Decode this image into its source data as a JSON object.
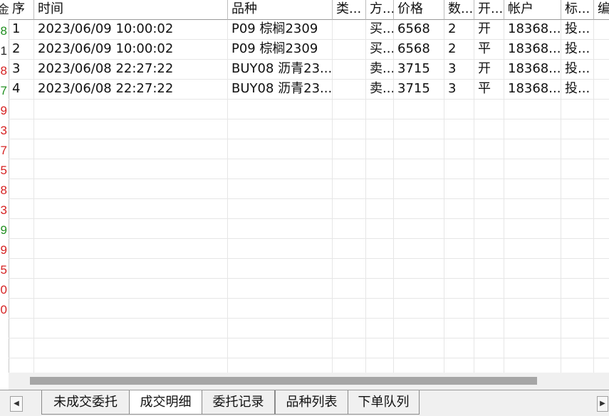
{
  "left_strip": {
    "header": "金",
    "values": [
      {
        "text": "8",
        "color": "#1f8f1f"
      },
      {
        "text": "1",
        "color": "#222222"
      },
      {
        "text": "8",
        "color": "#d62020"
      },
      {
        "text": "7",
        "color": "#1f8f1f"
      },
      {
        "text": "9",
        "color": "#d62020"
      },
      {
        "text": "3",
        "color": "#d62020"
      },
      {
        "text": "7",
        "color": "#d62020"
      },
      {
        "text": "5",
        "color": "#d62020"
      },
      {
        "text": "8",
        "color": "#d62020"
      },
      {
        "text": "3",
        "color": "#d62020"
      },
      {
        "text": "9",
        "color": "#1f8f1f"
      },
      {
        "text": "9",
        "color": "#d62020"
      },
      {
        "text": "5",
        "color": "#d62020"
      },
      {
        "text": "0",
        "color": "#d62020"
      },
      {
        "text": "0",
        "color": "#d62020"
      }
    ]
  },
  "table": {
    "columns": [
      "序",
      "时间",
      "品种",
      "类...",
      "方...",
      "价格",
      "数...",
      "开...",
      "帐户",
      "标...",
      "编"
    ],
    "rows": [
      [
        "1",
        "2023/06/09 10:00:02",
        "P09 棕榈2309",
        "",
        "买...",
        "6568",
        "2",
        "开",
        "18368...",
        "投..."
      ],
      [
        "2",
        "2023/06/09 10:00:02",
        "P09 棕榈2309",
        "",
        "买...",
        "6568",
        "2",
        "平",
        "18368...",
        "投..."
      ],
      [
        "3",
        "2023/06/08 22:27:22",
        "BUY08 沥青23...",
        "",
        "卖...",
        "3715",
        "3",
        "开",
        "18368...",
        "投..."
      ],
      [
        "4",
        "2023/06/08 22:27:22",
        "BUY08 沥青23...",
        "",
        "卖...",
        "3715",
        "3",
        "平",
        "18368...",
        "投..."
      ]
    ]
  },
  "tabs": [
    {
      "label": "未成交委托",
      "active": false
    },
    {
      "label": "成交明细",
      "active": true
    },
    {
      "label": "委托记录",
      "active": false
    },
    {
      "label": "品种列表",
      "active": false
    },
    {
      "label": "下单队列",
      "active": false
    }
  ],
  "nav": {
    "prev_icon": "◀",
    "next_icon": "▶"
  }
}
